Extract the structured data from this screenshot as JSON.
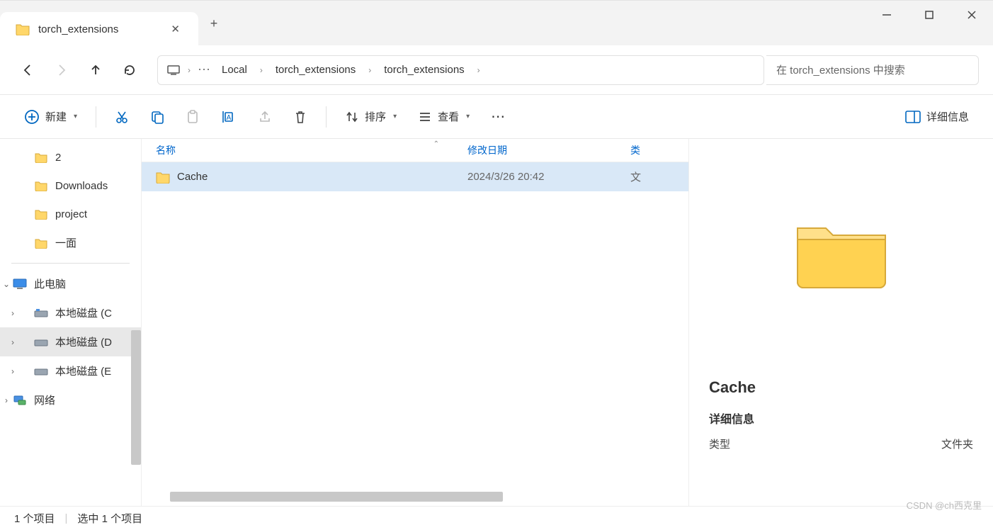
{
  "tab": {
    "title": "torch_extensions"
  },
  "breadcrumbs": {
    "root_icon": "computer",
    "items": [
      "Local",
      "torch_extensions",
      "torch_extensions"
    ]
  },
  "search": {
    "placeholder": "在 torch_extensions 中搜索"
  },
  "toolbar": {
    "new_label": "新建",
    "sort_label": "排序",
    "view_label": "查看",
    "details_label": "详细信息"
  },
  "sidebar": {
    "quick": [
      {
        "label": "2",
        "icon": "folder"
      },
      {
        "label": "Downloads",
        "icon": "folder"
      },
      {
        "label": "project",
        "icon": "folder"
      },
      {
        "label": "一面",
        "icon": "folder"
      }
    ],
    "thispc": {
      "label": "此电脑",
      "icon": "pc",
      "expand": "down"
    },
    "drives": [
      {
        "label": "本地磁盘 (C",
        "icon": "drive",
        "expand": "right",
        "selected": false
      },
      {
        "label": "本地磁盘 (D",
        "icon": "drive",
        "expand": "right",
        "selected": true
      },
      {
        "label": "本地磁盘 (E",
        "icon": "drive",
        "expand": "right",
        "selected": false
      }
    ],
    "network": {
      "label": "网络",
      "icon": "network",
      "expand": "right"
    }
  },
  "headers": {
    "name": "名称",
    "date": "修改日期",
    "type": "类"
  },
  "files": [
    {
      "name": "Cache",
      "date": "2024/3/26 20:42",
      "type": "文",
      "icon": "folder",
      "selected": true
    }
  ],
  "details": {
    "title": "Cache",
    "section": "详细信息",
    "type_label": "类型",
    "type_value": "文件夹"
  },
  "statusbar": {
    "count": "1 个项目",
    "selected": "选中 1 个项目"
  },
  "watermark": "CSDN @ch西克里"
}
